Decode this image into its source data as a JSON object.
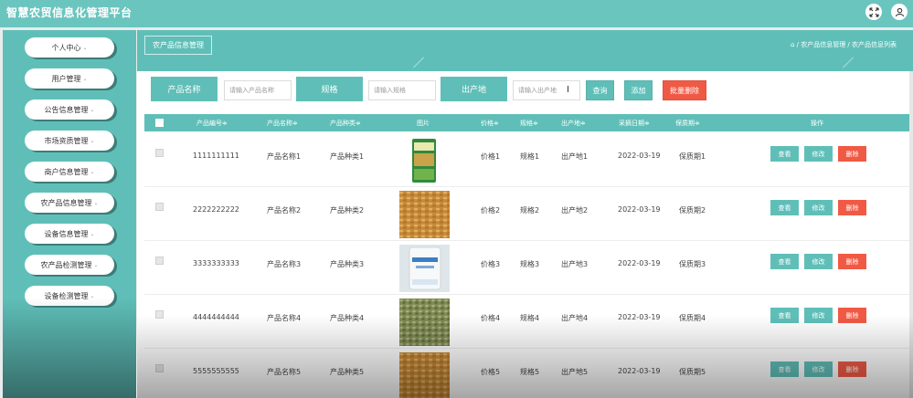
{
  "app": {
    "title": "智慧农贸信息化管理平台"
  },
  "header_icons": [
    {
      "icon": "expand-icon"
    },
    {
      "icon": "user-icon"
    }
  ],
  "sidebar": {
    "items": [
      {
        "label": "个人中心"
      },
      {
        "label": "用户管理"
      },
      {
        "label": "公告信息管理"
      },
      {
        "label": "市场资质管理"
      },
      {
        "label": "商户信息管理"
      },
      {
        "label": "农产品信息管理"
      },
      {
        "label": "设备信息管理"
      },
      {
        "label": "农产品检测管理"
      },
      {
        "label": "设备检测管理"
      }
    ],
    "chevron": "⌄"
  },
  "page": {
    "tab_label": "农产品信息管理",
    "breadcrumb": "⌂ / 农产品信息管理 / 农产品信息列表"
  },
  "search": {
    "fields": [
      {
        "label": "产品名称",
        "placeholder": "请输入产品名称"
      },
      {
        "label": "规格",
        "placeholder": "请输入规格"
      },
      {
        "label": "出产地",
        "placeholder": "请输入出产地"
      }
    ],
    "query_label": "查询",
    "add_label": "添加",
    "batch_delete_label": "批量删除"
  },
  "table": {
    "columns": [
      "产品编号≑",
      "产品名称≑",
      "产品种类≑",
      "图片",
      "价格≑",
      "规格≑",
      "出产地≑",
      "采摘日期≑",
      "保质期≑",
      "操作"
    ],
    "rows": [
      {
        "code": "1111111111",
        "name": "产品名称1",
        "kind": "产品种类1",
        "image": "seed-bag",
        "price": "价格1",
        "spec": "规格1",
        "origin": "出产地1",
        "date": "2022-03-19",
        "shelf": "保质期1"
      },
      {
        "code": "2222222222",
        "name": "产品名称2",
        "kind": "产品种类2",
        "image": "wheat-grains",
        "price": "价格2",
        "spec": "规格2",
        "origin": "出产地2",
        "date": "2022-03-19",
        "shelf": "保质期2"
      },
      {
        "code": "3333333333",
        "name": "产品名称3",
        "kind": "产品种类3",
        "image": "white-bag",
        "price": "价格3",
        "spec": "规格3",
        "origin": "出产地3",
        "date": "2022-03-19",
        "shelf": "保质期3"
      },
      {
        "code": "4444444444",
        "name": "产品名称4",
        "kind": "产品种类4",
        "image": "green-grains",
        "price": "价格4",
        "spec": "规格4",
        "origin": "出产地4",
        "date": "2022-03-19",
        "shelf": "保质期4"
      },
      {
        "code": "5555555555",
        "name": "产品名称5",
        "kind": "产品种类5",
        "image": "wheat-grains",
        "price": "价格5",
        "spec": "规格5",
        "origin": "出产地5",
        "date": "2022-03-19",
        "shelf": "保质期5"
      }
    ],
    "actions": {
      "view": "查看",
      "edit": "修改",
      "delete": "删除"
    }
  },
  "colors": {
    "accent": "#5fbfb8",
    "header": "#6bc5bf",
    "danger": "#f05a45"
  }
}
